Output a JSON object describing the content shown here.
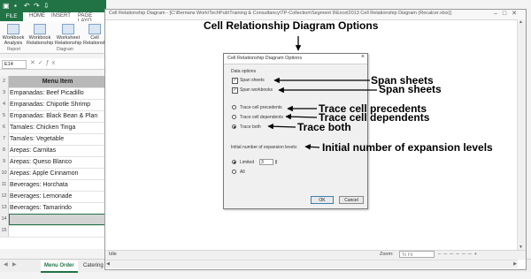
{
  "excel": {
    "tabs": [
      "FILE",
      "HOME",
      "INSERT",
      "PAGE LAYO"
    ],
    "ribbon_buttons": [
      "Workbook Analysis",
      "Workbook Relationship",
      "Worksheet Relationship",
      "Cell Relationship"
    ],
    "ribbon_groups": [
      "Report",
      "Diagram"
    ],
    "name_box": "E14",
    "row_numbers": [
      "2",
      "3",
      "4",
      "5",
      "6",
      "7",
      "8",
      "9",
      "10",
      "11",
      "12",
      "13",
      "14",
      "15"
    ],
    "header_cell": "Menu Item",
    "rows": [
      "Empanadas: Beef Picadillo",
      "Empanadas: Chipotle Shrimp",
      "Empanadas:  Black Bean & Plan",
      "Tamales: Chicken Tinga",
      "Tamales: Vegetable",
      "Arepas: Carnitas",
      "Arepas: Queso Blanco",
      "Arepas: Apple Cinnamon",
      "Beverages: Horchata",
      "Beverages: Lemonade",
      "Beverages: Tamarindo"
    ],
    "sheet_tabs": [
      "Menu Order",
      "Catering Bill"
    ]
  },
  "diagram_window": {
    "title": "Cell Relationship Diagram - [C:\\Berrians Work\\TechPub\\Training & Consultancy\\TP-Collection\\Segment 9\\Excel2013 Cell Relationship Diagram (Recalcer.xlsx)]",
    "status": "Idle",
    "zoom_label": "Zoom:",
    "zoom_value": "To Fit"
  },
  "dialog": {
    "title": "Cell Relationship Diagram Options",
    "close": "×",
    "section_label": "Data options",
    "span_sheets": "Span sheets",
    "span_workbooks": "Span workbooks",
    "trace_precedents": "Trace cell precedents",
    "trace_dependents": "Trace cell dependents",
    "trace_both": "Trace both",
    "expansion_label": "Initial number of expansion levels:",
    "limited": "Limited",
    "limited_value": "3",
    "all": "All",
    "ok": "OK",
    "cancel": "Cancel",
    "state": {
      "span_sheets_checked": true,
      "span_workbooks_checked": true,
      "trace_mode": "Trace both",
      "expansion_mode": "Limited"
    }
  },
  "annotations": {
    "title": "Cell Relationship Diagram Options",
    "span_sheets_1": "Span sheets",
    "span_sheets_2": "Span sheets",
    "trace_precedents": "Trace cell precedents",
    "trace_dependents": "Trace cell dependents",
    "trace_both": "Trace both",
    "expansion": "Initial number of expansion levels"
  },
  "colors": {
    "excel_green": "#217346",
    "header_fill": "#b8b8b8",
    "selected_row_fill": "#d4d4d4"
  }
}
